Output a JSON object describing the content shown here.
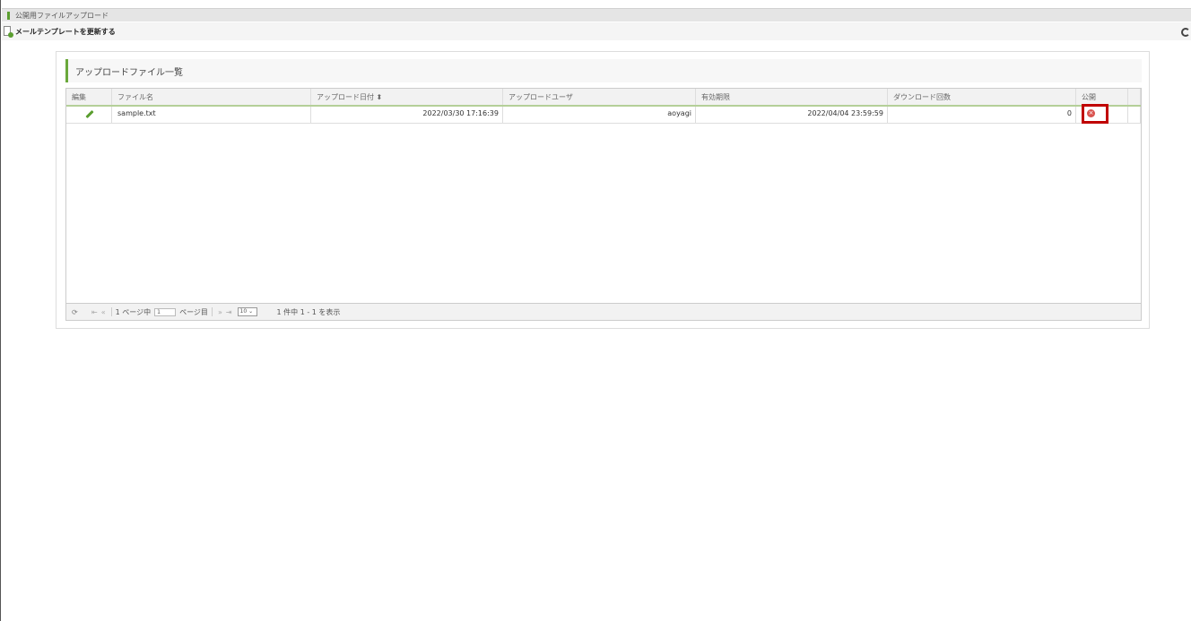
{
  "window": {
    "title": "公開用ファイルアップロード"
  },
  "toolbar": {
    "update_template_label": "メールテンプレートを更新する"
  },
  "panel": {
    "title": "アップロードファイル一覧"
  },
  "table": {
    "headers": [
      "編集",
      "ファイル名",
      "アップロード日付 ⬍",
      "アップロードユーザ",
      "有効期限",
      "ダウンロード回数",
      "公開"
    ],
    "rows": [
      {
        "filename": "sample.txt",
        "upload_date": "2022/03/30 17:16:39",
        "upload_user": "aoyagi",
        "expiry": "2022/04/04 23:59:59",
        "download_count": "0"
      }
    ]
  },
  "pager": {
    "reload_glyph": "⟳",
    "first_glyph": "⇤",
    "prev_glyph": "«",
    "page_prefix": "1 ページ中",
    "page_value": "1",
    "page_suffix": "ページ目",
    "next_glyph": "»",
    "last_glyph": "⇥",
    "page_size": "10 ⌄",
    "summary": "1 件中 1 - 1 を表示"
  },
  "colors": {
    "accent": "#6aa83b",
    "delete": "#d9534f",
    "highlight": "#c00000"
  }
}
